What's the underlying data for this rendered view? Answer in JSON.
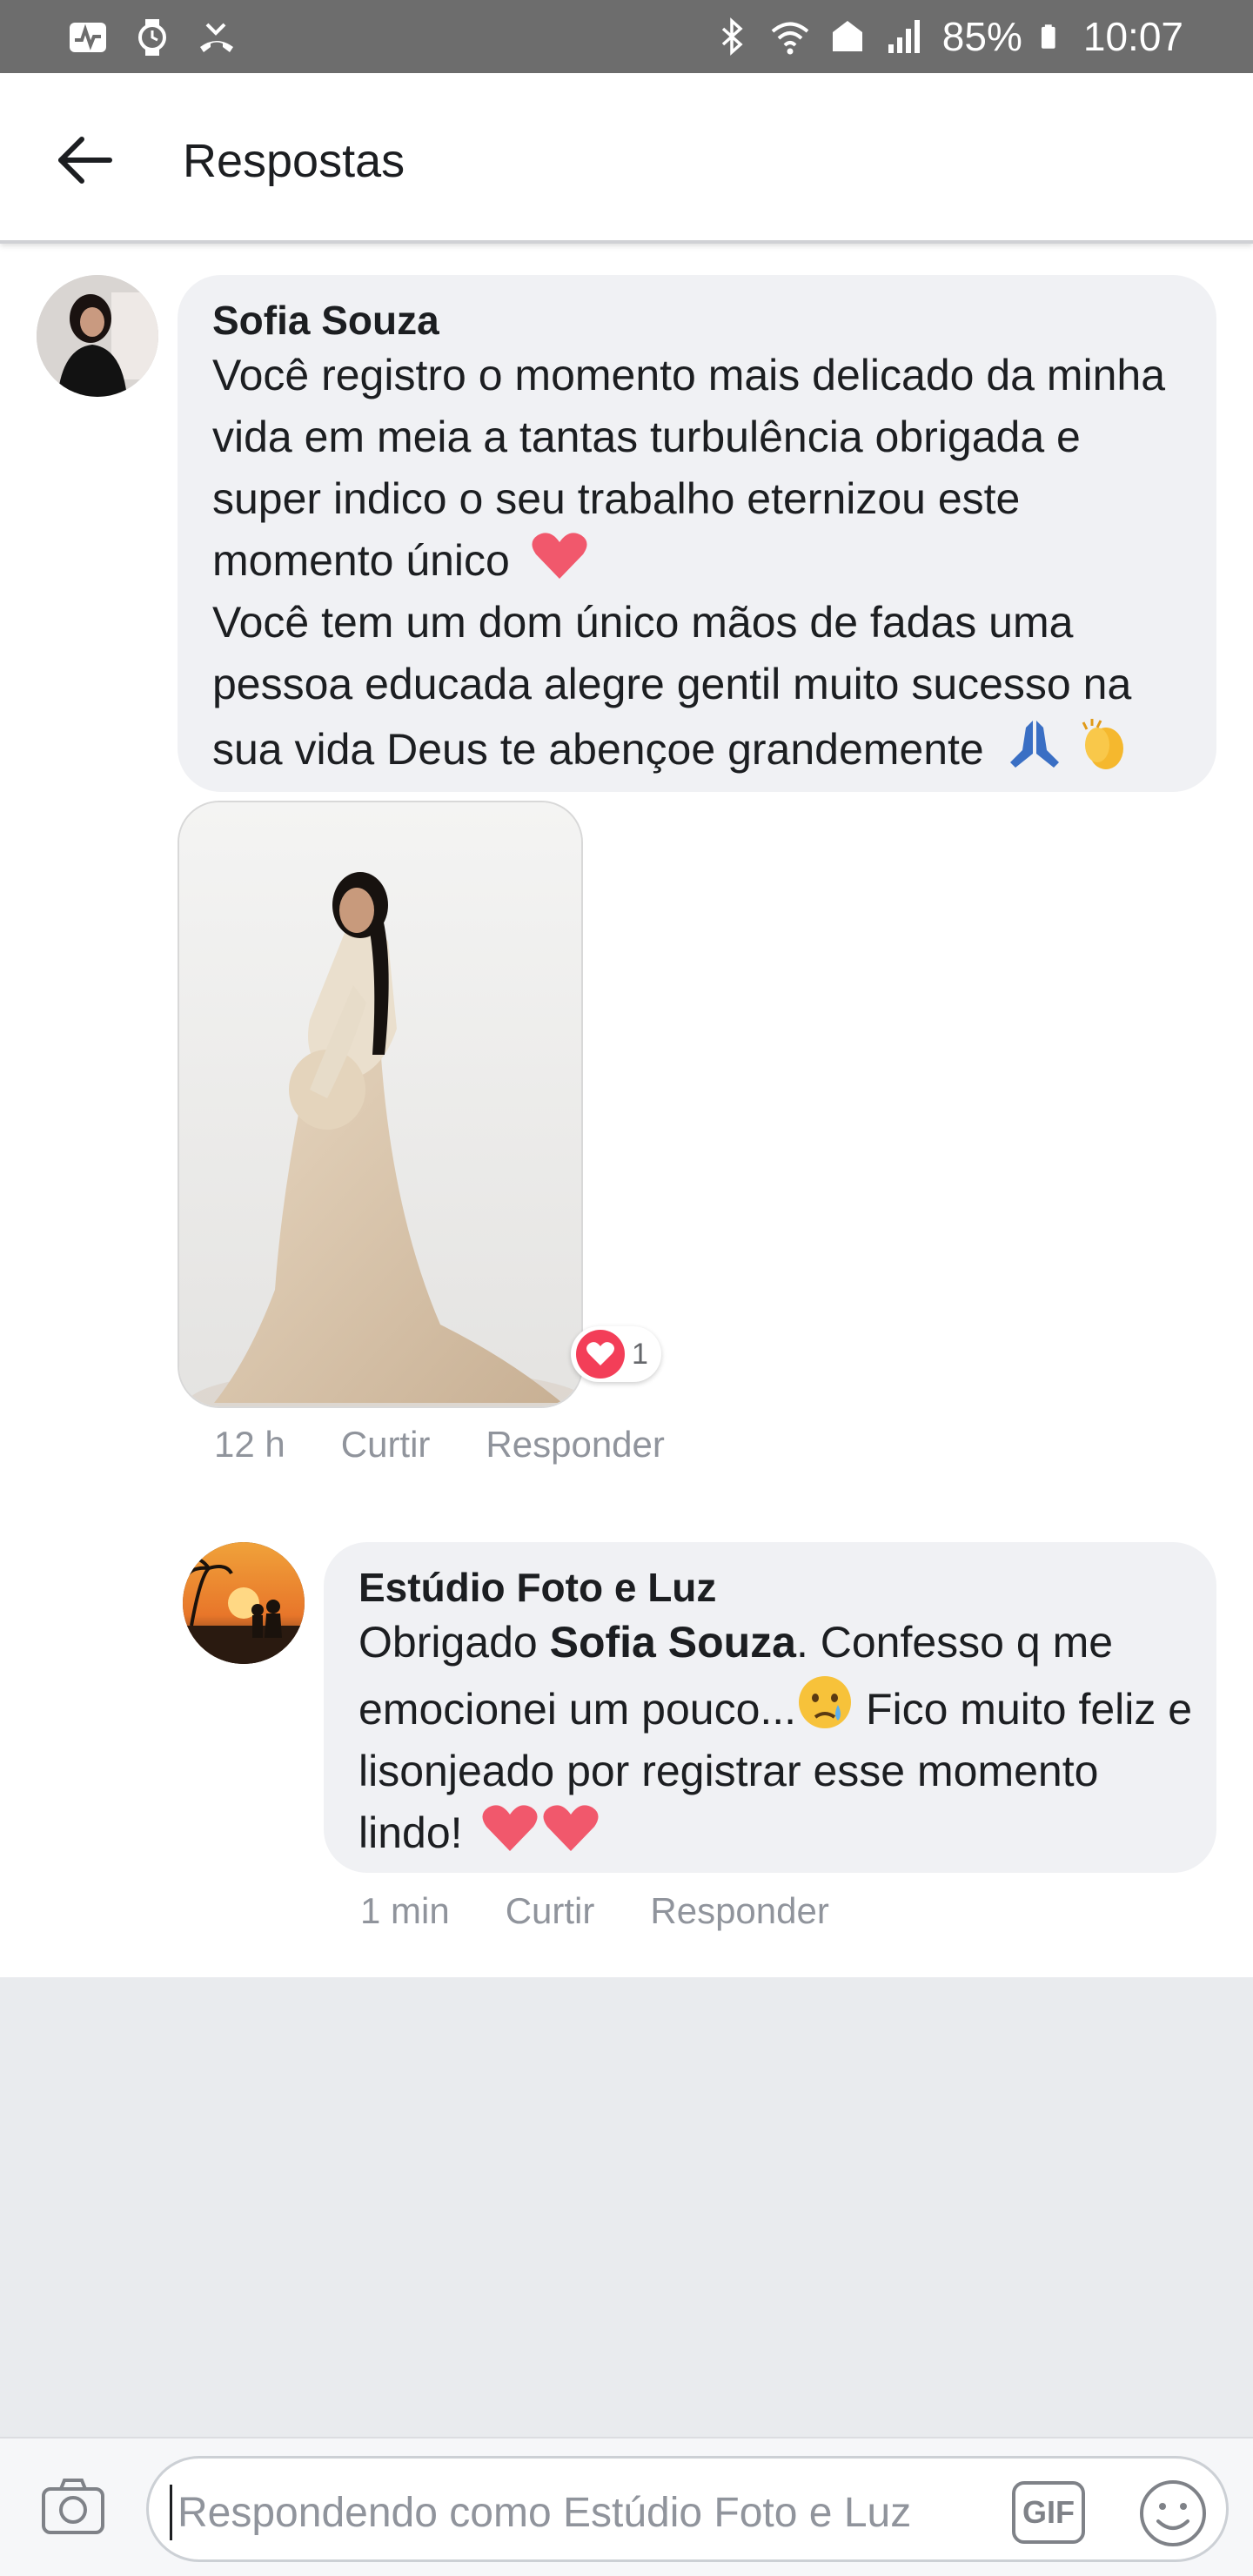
{
  "status_bar": {
    "battery": "85%",
    "time": "10:07",
    "left_icons": [
      "activity-icon",
      "watch-icon",
      "missed-call-icon"
    ],
    "right_icons": [
      "bluetooth-icon",
      "wifi-icon",
      "signal-icon",
      "battery-icon"
    ]
  },
  "header": {
    "title": "Respostas"
  },
  "comments": [
    {
      "author": "Sofia Souza",
      "text_lines": [
        "Você registro o momento mais delicado da minha",
        "vida em meia a tantas turbulência obrigada e",
        "super indico o seu trabalho eternizou este",
        "momento único",
        "Você tem um dom único mãos de fadas uma",
        "pessoa educada alegre gentil muito sucesso na",
        "sua vida Deus te abençoe grandemente"
      ],
      "reaction_count": "1",
      "time": "12 h",
      "like_label": "Curtir",
      "reply_label": "Responder"
    },
    {
      "author": "Estúdio Foto e Luz",
      "text_prefix": "Obrigado ",
      "mention": "Sofia Souza",
      "text_lines": [
        ". Confesso q me",
        "emocionei um pouco...",
        " Fico muito feliz e",
        "lisonjeado por registrar esse momento",
        "lindo!"
      ],
      "time": "1 min",
      "like_label": "Curtir",
      "reply_label": "Responder"
    }
  ],
  "composer": {
    "placeholder": "Respondendo como Estúdio Foto e Luz",
    "gif_label": "GIF"
  },
  "colors": {
    "status_bar": "#6d6d6d",
    "bubble": "#f0f1f4",
    "meta_text": "#90949c",
    "heart": "#f33e58",
    "empty_area": "#e9ebee"
  }
}
